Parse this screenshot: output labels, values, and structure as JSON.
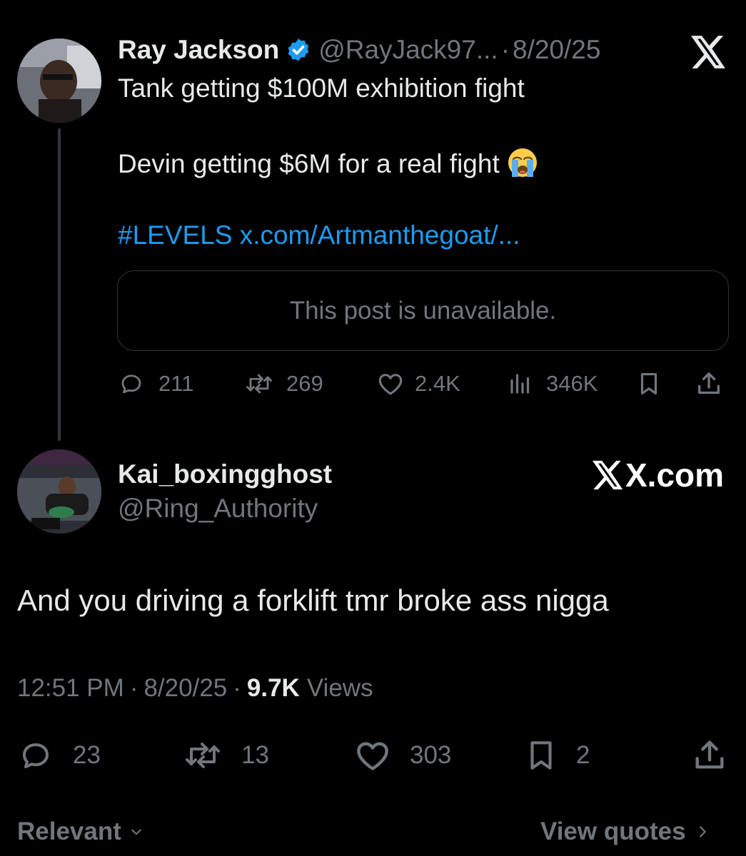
{
  "quoted_tweet": {
    "author_name": "Ray Jackson",
    "verified_icon": "verified-badge-icon",
    "handle": "@RayJack97...",
    "separator": "·",
    "date": "8/20/25",
    "line1": "Tank getting $100M exhibition fight",
    "line2": "Devin getting $6M for a real fight",
    "emoji": "loudly-crying-face-emoji",
    "hashtag": "#LEVELS",
    "link": "x.com/Artmanthegoat/...",
    "unavailable_text": "This post is unavailable.",
    "stats": {
      "replies": "211",
      "reposts": "269",
      "likes": "2.4K",
      "views": "346K"
    }
  },
  "main_tweet": {
    "author_name": "Kai_boxingghost",
    "handle": "@Ring_Authority",
    "watermark": "X.com",
    "text": "And you driving a forklift tmr broke ass nigga",
    "time": "12:51 PM",
    "separator": "·",
    "date": "8/20/25",
    "views_count": "9.7K",
    "views_label": "Views",
    "stats": {
      "replies": "23",
      "reposts": "13",
      "likes": "303",
      "bookmarks": "2"
    }
  },
  "footer": {
    "sort_label": "Relevant",
    "view_quotes_label": "View quotes"
  },
  "colors": {
    "background": "#000000",
    "text": "#e7e9ea",
    "secondary": "#71767b",
    "link": "#1d9bf0",
    "verified": "#1d9bf0"
  }
}
